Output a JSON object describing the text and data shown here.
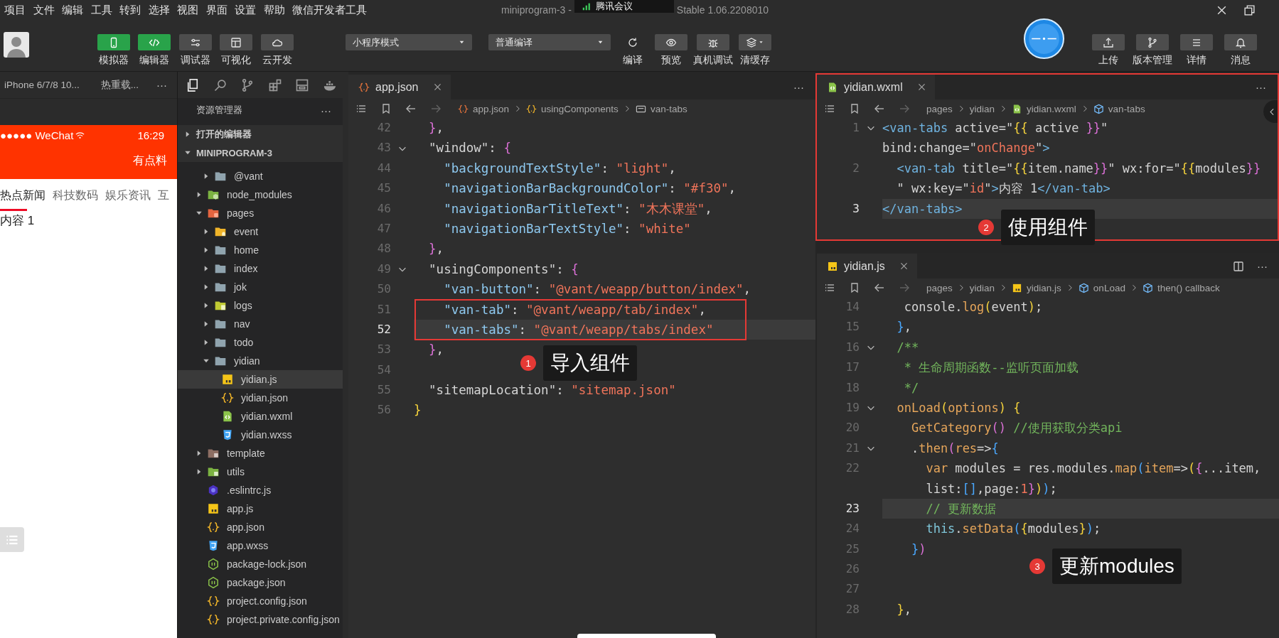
{
  "menu_bar": {
    "items": [
      "项目",
      "文件",
      "编辑",
      "工具",
      "转到",
      "选择",
      "视图",
      "界面",
      "设置",
      "帮助",
      "微信开发者工具"
    ],
    "title_start": "miniprogram-3 -",
    "meeting_indicator": "腾讯会议",
    "title_end": "Stable 1.06.2208010"
  },
  "toolbar": {
    "view_buttons": [
      {
        "label": "模拟器",
        "selected": true
      },
      {
        "label": "编辑器",
        "selected": true
      },
      {
        "label": "调试器",
        "selected": false
      },
      {
        "label": "可视化",
        "selected": false
      },
      {
        "label": "云开发",
        "selected": false
      }
    ],
    "mode_select": "小程序模式",
    "compile_select": "普通编译",
    "actions": [
      {
        "label": "编译",
        "kind": "plain"
      },
      {
        "label": "预览",
        "kind": "boxed"
      },
      {
        "label": "真机调试",
        "kind": "boxed"
      },
      {
        "label": "清缓存",
        "kind": "boxed"
      }
    ],
    "right_buttons": [
      {
        "label": "上传"
      },
      {
        "label": "版本管理"
      },
      {
        "label": "详情"
      },
      {
        "label": "消息"
      }
    ]
  },
  "simulator": {
    "device": "iPhone 6/7/8 10...",
    "hot_reload": "热重载...",
    "more": "···",
    "carrier": "●●●●● WeChat",
    "time": "16:29",
    "nav_title": "有点料",
    "tabs": [
      {
        "label": "热点新闻",
        "selected": true
      },
      {
        "label": "科技数码",
        "selected": false
      },
      {
        "label": "娱乐资讯",
        "selected": false
      },
      {
        "label": "互",
        "selected": false
      }
    ],
    "content": "内容 1"
  },
  "explorer": {
    "title": "资源管理器",
    "more": "···",
    "sections": [
      {
        "label": "打开的编辑器",
        "expanded": false
      },
      {
        "label": "MINIPROGRAM-3",
        "expanded": true
      }
    ],
    "clipped_children": [
      {
        "label": "@vant",
        "kind": "folder",
        "expanded": false,
        "selected": false
      }
    ],
    "tree": [
      {
        "label": "node_modules",
        "kind": "folder-node",
        "expanded": false,
        "selected": false
      },
      {
        "label": "pages",
        "kind": "folder-pages",
        "expanded": true,
        "selected": false,
        "children": [
          {
            "label": "event",
            "kind": "folder-event",
            "expanded": false,
            "selected": false
          },
          {
            "label": "home",
            "kind": "folder",
            "expanded": false,
            "selected": false
          },
          {
            "label": "index",
            "kind": "folder",
            "expanded": false,
            "selected": false
          },
          {
            "label": "jok",
            "kind": "folder",
            "expanded": false,
            "selected": false
          },
          {
            "label": "logs",
            "kind": "folder-logs",
            "expanded": false,
            "selected": false
          },
          {
            "label": "nav",
            "kind": "folder",
            "expanded": false,
            "selected": false
          },
          {
            "label": "todo",
            "kind": "folder",
            "expanded": false,
            "selected": false
          },
          {
            "label": "yidian",
            "kind": "folder",
            "expanded": true,
            "selected": false,
            "children": [
              {
                "label": "yidian.js",
                "kind": "js",
                "selected": true
              },
              {
                "label": "yidian.json",
                "kind": "json",
                "selected": false
              },
              {
                "label": "yidian.wxml",
                "kind": "wxml",
                "selected": false
              },
              {
                "label": "yidian.wxss",
                "kind": "wxss",
                "selected": false
              }
            ]
          }
        ]
      },
      {
        "label": "template",
        "kind": "folder-template",
        "expanded": false,
        "selected": false
      },
      {
        "label": "utils",
        "kind": "folder-utils",
        "expanded": false,
        "selected": false
      },
      {
        "label": ".eslintrc.js",
        "kind": "eslint",
        "selected": false
      },
      {
        "label": "app.js",
        "kind": "js",
        "selected": false
      },
      {
        "label": "app.json",
        "kind": "json",
        "selected": false
      },
      {
        "label": "app.wxss",
        "kind": "wxss",
        "selected": false
      },
      {
        "label": "package-lock.json",
        "kind": "npm",
        "selected": false
      },
      {
        "label": "package.json",
        "kind": "npm",
        "selected": false
      },
      {
        "label": "project.config.json",
        "kind": "json",
        "selected": false
      },
      {
        "label": "project.private.config.json",
        "kind": "json",
        "selected": false
      }
    ]
  },
  "editors": [
    {
      "tab": {
        "label": "app.json",
        "kind": "json"
      },
      "more": "···",
      "framed": false,
      "breadcrumb": [
        {
          "text": "app.json",
          "kind": "json"
        },
        {
          "text": "usingComponents",
          "kind": "object"
        },
        {
          "text": "van-tabs",
          "kind": "string"
        }
      ],
      "lines": [
        {
          "num": "42",
          "foldable": false,
          "current": false,
          "boxed": false,
          "tokens": [
            {
              "text": "  }",
              "kind": "m"
            },
            {
              "text": ",",
              "kind": "p"
            }
          ]
        },
        {
          "num": "43",
          "foldable": true,
          "current": false,
          "boxed": false,
          "tokens": [
            {
              "text": "  \"window\": ",
              "kind": "p"
            },
            {
              "text": "{",
              "kind": "m"
            }
          ]
        },
        {
          "num": "44",
          "foldable": false,
          "current": false,
          "boxed": false,
          "tokens": [
            {
              "text": "    \"backgroundTextStyle\"",
              "kind": "k"
            },
            {
              "text": ": ",
              "kind": "p"
            },
            {
              "text": "\"light\"",
              "kind": "s"
            },
            {
              "text": ",",
              "kind": "p"
            }
          ]
        },
        {
          "num": "45",
          "foldable": false,
          "current": false,
          "boxed": false,
          "tokens": [
            {
              "text": "    \"navigationBarBackgroundColor\"",
              "kind": "k"
            },
            {
              "text": ": ",
              "kind": "p"
            },
            {
              "text": "\"#f30\"",
              "kind": "s"
            },
            {
              "text": ",",
              "kind": "p"
            }
          ]
        },
        {
          "num": "46",
          "foldable": false,
          "current": false,
          "boxed": false,
          "tokens": [
            {
              "text": "    \"navigationBarTitleText\"",
              "kind": "k"
            },
            {
              "text": ": ",
              "kind": "p"
            },
            {
              "text": "\"木木课堂\"",
              "kind": "s"
            },
            {
              "text": ",",
              "kind": "p"
            }
          ]
        },
        {
          "num": "47",
          "foldable": false,
          "current": false,
          "boxed": false,
          "tokens": [
            {
              "text": "    \"navigationBarTextStyle\"",
              "kind": "k"
            },
            {
              "text": ": ",
              "kind": "p"
            },
            {
              "text": "\"white\"",
              "kind": "s"
            }
          ]
        },
        {
          "num": "48",
          "foldable": false,
          "current": false,
          "boxed": false,
          "tokens": [
            {
              "text": "  }",
              "kind": "m"
            },
            {
              "text": ",",
              "kind": "p"
            }
          ]
        },
        {
          "num": "49",
          "foldable": true,
          "current": false,
          "boxed": false,
          "tokens": [
            {
              "text": "  \"usingComponents\": ",
              "kind": "p"
            },
            {
              "text": "{",
              "kind": "m"
            }
          ]
        },
        {
          "num": "50",
          "foldable": false,
          "current": false,
          "boxed": false,
          "tokens": [
            {
              "text": "    \"van-button\"",
              "kind": "k"
            },
            {
              "text": ": ",
              "kind": "p"
            },
            {
              "text": "\"@vant/weapp/button/index\"",
              "kind": "s"
            },
            {
              "text": ",",
              "kind": "p"
            }
          ]
        },
        {
          "num": "51",
          "foldable": false,
          "current": false,
          "boxed": true,
          "tokens": [
            {
              "text": "    \"van-tab\"",
              "kind": "k"
            },
            {
              "text": ": ",
              "kind": "p"
            },
            {
              "text": "\"@vant/weapp/tab/index\"",
              "kind": "s"
            },
            {
              "text": ",",
              "kind": "p"
            }
          ]
        },
        {
          "num": "52",
          "foldable": false,
          "current": true,
          "boxed": true,
          "tokens": [
            {
              "text": "    \"van-tabs\"",
              "kind": "k"
            },
            {
              "text": ": ",
              "kind": "p"
            },
            {
              "text": "\"@vant/weapp/tabs/index\"",
              "kind": "s"
            }
          ]
        },
        {
          "num": "53",
          "foldable": false,
          "current": false,
          "boxed": false,
          "tokens": [
            {
              "text": "  }",
              "kind": "m"
            },
            {
              "text": ",",
              "kind": "p"
            }
          ]
        },
        {
          "num": "54",
          "foldable": false,
          "current": false,
          "boxed": false
        },
        {
          "num": "55",
          "foldable": false,
          "current": false,
          "boxed": false,
          "tokens": [
            {
              "text": "  \"sitemapLocation\": ",
              "kind": "p"
            },
            {
              "text": "\"sitemap.json\"",
              "kind": "s"
            }
          ]
        },
        {
          "num": "56",
          "foldable": false,
          "current": false,
          "boxed": false,
          "tokens": [
            {
              "text": "}",
              "kind": "y"
            }
          ]
        }
      ],
      "annotation": {
        "number": "1",
        "label": "导入组件"
      }
    },
    {
      "tab": {
        "label": "yidian.wxml",
        "kind": "wxml"
      },
      "more": "···",
      "framed": true,
      "breadcrumb": [
        {
          "text": "pages",
          "kind": "path"
        },
        {
          "text": "yidian",
          "kind": "path"
        },
        {
          "text": "yidian.wxml",
          "kind": "wxml"
        },
        {
          "text": "van-tabs",
          "kind": "method"
        }
      ],
      "lines": [
        {
          "num": "1",
          "foldable": true,
          "current": false,
          "tokens": [
            {
              "text": "<van-tabs",
              "kind": "t"
            },
            {
              "text": " active=\"",
              "kind": "p"
            },
            {
              "text": "{{",
              "kind": "y"
            },
            {
              "text": " active ",
              "kind": "p"
            },
            {
              "text": "}}",
              "kind": "m"
            },
            {
              "text": "\"",
              "kind": "p"
            }
          ]
        },
        {
          "foldable": false,
          "current": false,
          "tokens": [
            {
              "text": "bind:change=\"",
              "kind": "p"
            },
            {
              "text": "onChange",
              "kind": "s"
            },
            {
              "text": "\"",
              "kind": "p"
            },
            {
              "text": ">",
              "kind": "t"
            }
          ]
        },
        {
          "num": "2",
          "foldable": false,
          "current": false,
          "tokens": [
            {
              "text": "  <van-tab",
              "kind": "t"
            },
            {
              "text": " title=\"",
              "kind": "p"
            },
            {
              "text": "{{",
              "kind": "y"
            },
            {
              "text": "item.name",
              "kind": "p"
            },
            {
              "text": "}}",
              "kind": "m"
            },
            {
              "text": "\" wx:for=\"",
              "kind": "p"
            },
            {
              "text": "{{",
              "kind": "y"
            },
            {
              "text": "modules",
              "kind": "p"
            },
            {
              "text": "}}",
              "kind": "m"
            }
          ]
        },
        {
          "foldable": false,
          "current": false,
          "tokens": [
            {
              "text": "  \" wx:key=\"",
              "kind": "p"
            },
            {
              "text": "id",
              "kind": "s"
            },
            {
              "text": "\"",
              "kind": "p"
            },
            {
              "text": ">",
              "kind": "t"
            },
            {
              "text": "内容 1",
              "kind": "p"
            },
            {
              "text": "</van-tab>",
              "kind": "t"
            }
          ]
        },
        {
          "num": "3",
          "foldable": false,
          "current": true,
          "tokens": [
            {
              "text": "</van-tabs>",
              "kind": "t"
            }
          ]
        }
      ],
      "annotation": {
        "number": "2",
        "label": "使用组件"
      }
    },
    {
      "tab": {
        "label": "yidian.js",
        "kind": "js"
      },
      "more": "···",
      "framed": false,
      "breadcrumb": [
        {
          "text": "pages",
          "kind": "path"
        },
        {
          "text": "yidian",
          "kind": "path"
        },
        {
          "text": "yidian.js",
          "kind": "js"
        },
        {
          "text": "onLoad",
          "kind": "method"
        },
        {
          "text": "then() callback",
          "kind": "method"
        }
      ],
      "lines": [
        {
          "num": "14",
          "foldable": false,
          "current": false,
          "tokens": [
            {
              "text": "   console.",
              "kind": "p"
            },
            {
              "text": "log",
              "kind": "f"
            },
            {
              "text": "(",
              "kind": "y"
            },
            {
              "text": "event",
              "kind": "p"
            },
            {
              "text": ")",
              "kind": "y"
            },
            {
              "text": ";",
              "kind": "p"
            }
          ]
        },
        {
          "num": "15",
          "foldable": false,
          "current": false,
          "tokens": [
            {
              "text": "  }",
              "kind": "b"
            },
            {
              "text": ",",
              "kind": "p"
            }
          ]
        },
        {
          "num": "16",
          "foldable": true,
          "current": false,
          "tokens": [
            {
              "text": "  /**",
              "kind": "c"
            }
          ]
        },
        {
          "num": "17",
          "foldable": false,
          "current": false,
          "tokens": [
            {
              "text": "   * 生命周期函数--监听页面加载",
              "kind": "c"
            }
          ]
        },
        {
          "num": "18",
          "foldable": false,
          "current": false,
          "tokens": [
            {
              "text": "   */",
              "kind": "c"
            }
          ]
        },
        {
          "num": "19",
          "foldable": true,
          "current": false,
          "tokens": [
            {
              "text": "  onLoad",
              "kind": "f"
            },
            {
              "text": "(",
              "kind": "y"
            },
            {
              "text": "options",
              "kind": "f"
            },
            {
              "text": ")",
              "kind": "y"
            },
            {
              "text": " {",
              "kind": "y"
            }
          ]
        },
        {
          "num": "20",
          "foldable": false,
          "current": false,
          "tokens": [
            {
              "text": "    GetCategory",
              "kind": "f"
            },
            {
              "text": "()",
              "kind": "m"
            },
            {
              "text": " //使用获取分类api",
              "kind": "c"
            }
          ]
        },
        {
          "num": "21",
          "foldable": true,
          "current": false,
          "tokens": [
            {
              "text": "    .",
              "kind": "p"
            },
            {
              "text": "then",
              "kind": "f"
            },
            {
              "text": "(",
              "kind": "m"
            },
            {
              "text": "res",
              "kind": "f"
            },
            {
              "text": "=>",
              "kind": "p"
            },
            {
              "text": "{",
              "kind": "b"
            }
          ]
        },
        {
          "num": "22",
          "foldable": false,
          "current": false,
          "tokens": [
            {
              "text": "      var",
              "kind": "f"
            },
            {
              "text": " modules = res.modules.",
              "kind": "p"
            },
            {
              "text": "map",
              "kind": "f"
            },
            {
              "text": "(",
              "kind": "b"
            },
            {
              "text": "item",
              "kind": "f"
            },
            {
              "text": "=>",
              "kind": "p"
            },
            {
              "text": "(",
              "kind": "y"
            },
            {
              "text": "{",
              "kind": "m"
            },
            {
              "text": "...item,",
              "kind": "p"
            }
          ]
        },
        {
          "foldable": false,
          "current": false,
          "tokens": [
            {
              "text": "      list:",
              "kind": "p"
            },
            {
              "text": "[]",
              "kind": "b"
            },
            {
              "text": ",page:",
              "kind": "p"
            },
            {
              "text": "1",
              "kind": "n"
            },
            {
              "text": "}",
              "kind": "m"
            },
            {
              "text": ")",
              "kind": "y"
            },
            {
              "text": ")",
              "kind": "b"
            },
            {
              "text": ";",
              "kind": "p"
            }
          ]
        },
        {
          "num": "23",
          "foldable": false,
          "current": true,
          "tokens": [
            {
              "text": "      // 更新数据",
              "kind": "c"
            }
          ]
        },
        {
          "num": "24",
          "foldable": false,
          "current": false,
          "tokens": [
            {
              "text": "      this",
              "kind": "v"
            },
            {
              "text": ".",
              "kind": "p"
            },
            {
              "text": "setData",
              "kind": "f"
            },
            {
              "text": "(",
              "kind": "b"
            },
            {
              "text": "{",
              "kind": "y"
            },
            {
              "text": "modules",
              "kind": "p"
            },
            {
              "text": "}",
              "kind": "y"
            },
            {
              "text": ")",
              "kind": "b"
            },
            {
              "text": ";",
              "kind": "p"
            }
          ]
        },
        {
          "num": "25",
          "foldable": false,
          "current": false,
          "tokens": [
            {
              "text": "    }",
              "kind": "b"
            },
            {
              "text": ")",
              "kind": "m"
            }
          ]
        },
        {
          "num": "26",
          "foldable": false,
          "current": false
        },
        {
          "num": "27",
          "foldable": false,
          "current": false
        },
        {
          "num": "28",
          "foldable": false,
          "current": false,
          "tokens": [
            {
              "text": "  }",
              "kind": "y"
            },
            {
              "text": ",",
              "kind": "p"
            }
          ]
        }
      ],
      "annotation": {
        "number": "3",
        "label": "更新modules"
      }
    }
  ]
}
